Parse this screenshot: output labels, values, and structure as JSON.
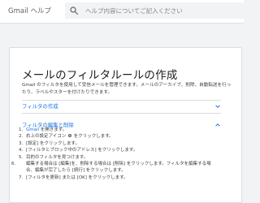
{
  "header": {
    "brand": "Gmail ヘルプ",
    "search_placeholder": "ヘルプ内容についてご記入ください",
    "search_icon": "search-icon"
  },
  "article": {
    "title": "メールのフィルタルールの作成",
    "intro": "Gmail のフィルタを使用して受信メールを管理できます。メールのアーカイブ、削除、自動転送を行ったり、ラベルやスターを付けたりできます。",
    "sections": [
      {
        "label": "フィルタの作成",
        "expanded": false,
        "icon": "chevron-down-icon"
      },
      {
        "label": "フィルタの編集と削除",
        "expanded": true,
        "icon": "chevron-up-icon"
      }
    ],
    "steps": [
      {
        "num": "1.",
        "pre": "",
        "link": "Gmail",
        "post": " を開きます。"
      },
      {
        "num": "2.",
        "pre": "右上の設定アイコン ",
        "post": " をクリックします。"
      },
      {
        "num": "3.",
        "text": "[設定] をクリックします。"
      },
      {
        "num": "4.",
        "text": "[フィルタとブロック中のアドレス] をクリックします。"
      },
      {
        "num": "5.",
        "text": "目的のフィルタを見つけます。"
      },
      {
        "num": "6.",
        "text": "編集する場合は [編集]を、削除する場合は [削除] をクリックします。フィルタを編集する場合、編集が完了したら [続行] をクリックします。"
      },
      {
        "num": "7.",
        "text": "[フィルタを更新] または [OK] をクリックします。"
      }
    ]
  },
  "colors": {
    "link": "#1a73e8",
    "text": "#3c4043",
    "background": "#f1f3f4"
  }
}
